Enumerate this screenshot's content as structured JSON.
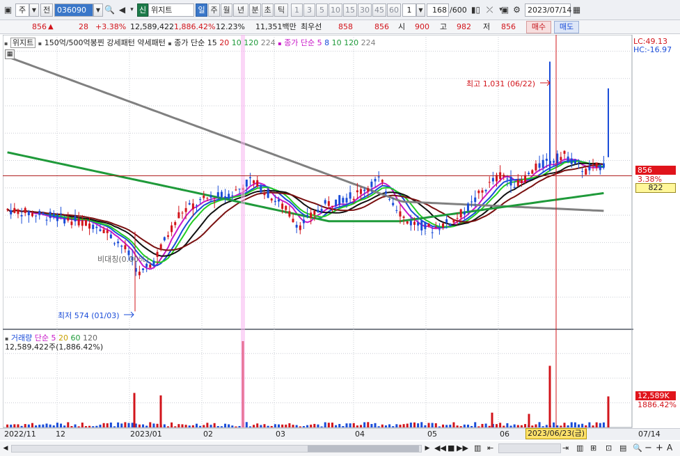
{
  "toolbar": {
    "market": "주",
    "prev": "전",
    "code": "036090",
    "badge": "신",
    "stock_name": "위지트",
    "periods": [
      "일",
      "주",
      "월",
      "년",
      "분",
      "초",
      "틱"
    ],
    "active_period": "일",
    "minutes": [
      "1",
      "3",
      "5",
      "10",
      "15",
      "30",
      "45",
      "60"
    ],
    "multiplier": "1",
    "count": "168",
    "count_total": "/600",
    "date": "2023/07/14"
  },
  "quote": {
    "price": "856",
    "change": "28",
    "change_pct": "+3.38%",
    "volume": "12,589,422",
    "volume_pct": "1,886.42%",
    "turnover_rate": "12.23%",
    "amount": "11,351백만",
    "best_ask_label": "최우선",
    "best_ask": "858",
    "best_bid": "856",
    "open_label": "시",
    "open": "900",
    "high_label": "고",
    "high": "982",
    "low_label": "저",
    "low": "856",
    "buy_label": "매수",
    "sell_label": "매도"
  },
  "legend": {
    "name": "위지트",
    "pattern": "150억/500억봉찐 강세패턴",
    "weak": "약세패턴",
    "ma1_label": "종가 단순",
    "ma1_periods": [
      "15",
      "20",
      "10",
      "120",
      "224"
    ],
    "ma2_label": "종가 단순",
    "ma2_periods": [
      "5",
      "8",
      "10",
      "120",
      "224"
    ],
    "lc": "LC:49.13",
    "hc": "HC:-16.97"
  },
  "annotations": {
    "high": "최고 1,031 (06/22)",
    "low": "최저 574 (01/03)",
    "faint": "비대칭(0.00%)",
    "price_tag": "856",
    "pct_tag": "3.38%",
    "ref_tag": "822"
  },
  "volume_legend": {
    "label": "거래량",
    "ma_label": "단순",
    "periods": [
      "5",
      "20",
      "60",
      "120"
    ],
    "value": "12,589,422주(1,886.42%)",
    "tag_value": "12,589K",
    "tag_pct": "1886.42%"
  },
  "footer": {
    "x_labels": [
      "2022/11",
      "12",
      "2023/01",
      "02",
      "03",
      "04",
      "05",
      "06"
    ],
    "cursor_date": "2023/06/23(금)",
    "right_date": "07/14"
  },
  "colors": {
    "up": "#d2141b",
    "down": "#1a4cd8",
    "ma_green": "#1f9a3a",
    "ma_gray": "#808080",
    "ma_magenta": "#c818c8"
  },
  "chart_data": {
    "type": "candlestick",
    "price_axis": {
      "ticks": [
        600,
        650,
        700,
        750,
        800,
        850,
        900,
        950,
        1000,
        1050
      ],
      "min": 545,
      "max": 1080
    },
    "volume_axis": {
      "ticks": [
        10000,
        20000,
        30000
      ],
      "unit": "K",
      "max": 35000
    },
    "high": 1031,
    "low": 574,
    "last_close": 856,
    "reference": 822
  }
}
